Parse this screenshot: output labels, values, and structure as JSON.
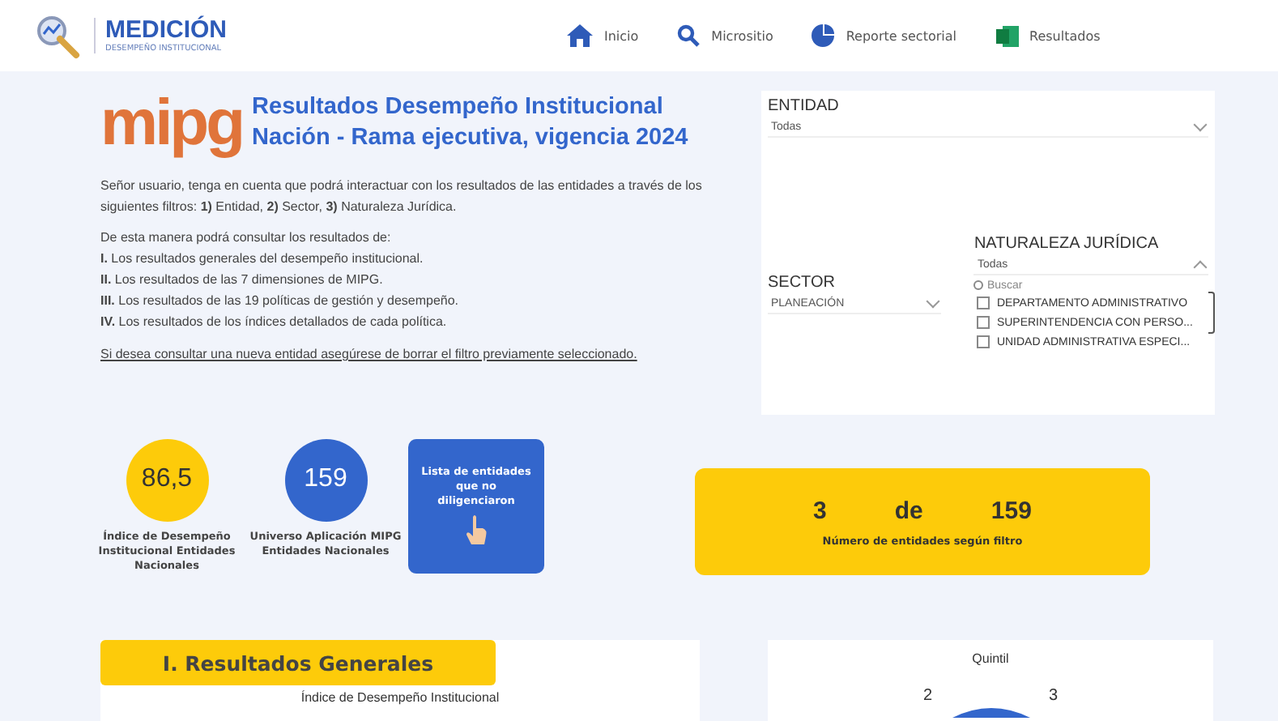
{
  "header": {
    "brand": "MEDICIÓN",
    "tagline": "DESEMPEÑO INSTITUCIONAL",
    "nav": [
      {
        "label": "Inicio",
        "kind": "home"
      },
      {
        "label": "Micrositio",
        "kind": "search"
      },
      {
        "label": "Reporte sectorial",
        "kind": "pie"
      },
      {
        "label": "Resultados",
        "kind": "excel"
      }
    ]
  },
  "intro": {
    "logo": "mipg",
    "title": [
      "Resultados Desempeño Institucional",
      "Nación - Rama ejecutiva, vigencia 2024"
    ],
    "paragraph": "Señor usuario, tenga en cuenta que podrá interactuar con los resultados de las entidades a través de los siguientes filtros: **1)**  Entidad, **2)**  Sector, **3)**  Naturaleza Jurídica.",
    "list_heading": "De esta manera podrá consultar los resultados de:",
    "list": [
      "**I.**  Los resultados generales del desempeño institucional.",
      "**II.**  Los resultados de las 7 dimensiones de MIPG.",
      "**III.** Los resultados de las 19 políticas de gestión y desempeño.",
      "**IV.** Los resultados de los índices detallados de cada política."
    ],
    "note": "Si desea consultar una nueva entidad asegúrese de borrar el filtro previamente seleccionado."
  },
  "filters": {
    "entidad": {
      "label": "ENTIDAD",
      "value": "Todas",
      "expanded": false
    },
    "sector": {
      "label": "SECTOR",
      "value": "PLANEACIÓN",
      "expanded": false
    },
    "naturaleza": {
      "label": "NATURALEZA JURÍDICA",
      "value": "Todas",
      "expanded": true,
      "placeholder": "Buscar",
      "options": [
        {
          "label": "DEPARTAMENTO ADMINISTRATIVO",
          "checked": false
        },
        {
          "label": "SUPERINTENDENCIA CON PERSO...",
          "checked": false
        },
        {
          "label": "UNIDAD ADMINISTRATIVA ESPECI...",
          "checked": false
        }
      ]
    }
  },
  "kpis": [
    {
      "value": "86,5",
      "label": "Índice de Desempeño Institucional Entidades Nacionales",
      "color": "#fdcb0a"
    },
    {
      "value": "159",
      "label": "Universo Aplicación MIPG Entidades Nacionales",
      "color": "#3366cc"
    }
  ],
  "list_button": "Lista de entidades que no diligenciaron",
  "counter": {
    "count": "3",
    "of": "de",
    "total": "159",
    "caption": "Número de entidades según filtro"
  },
  "section": {
    "heading": "I. Resultados Generales",
    "subtitle": "Índice de Desempeño Institucional"
  },
  "quintil": {
    "title": "Quintil",
    "labels": [
      "2",
      "3"
    ]
  }
}
